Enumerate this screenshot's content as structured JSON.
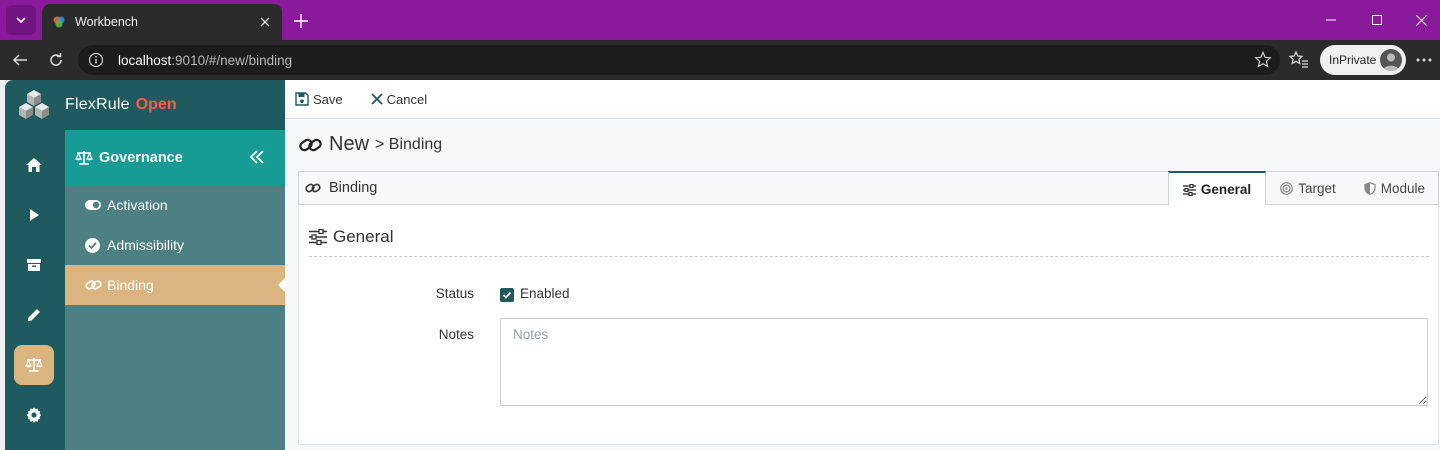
{
  "browser": {
    "tab_title": "Workbench",
    "url_host": "localhost",
    "url_rest": ":9010/#/new/binding",
    "profile_label": "InPrivate"
  },
  "app": {
    "brand": "FlexRule",
    "brand_accent": "Open",
    "colors": {
      "teal_dark": "#1f5a5e",
      "teal": "#169c94",
      "sand": "#dbb57f",
      "accent": "#ff5a4a"
    },
    "rail_icons": [
      "home-icon",
      "play-icon",
      "archive-icon",
      "pencil-icon",
      "scale-icon",
      "gear-icon"
    ],
    "menu": {
      "title": "Governance",
      "items": [
        {
          "label": "Activation",
          "icon": "toggle-icon"
        },
        {
          "label": "Admissibility",
          "icon": "check-circle-icon"
        },
        {
          "label": "Binding",
          "icon": "link-icon",
          "active": true
        }
      ]
    },
    "actions": {
      "save": "Save",
      "cancel": "Cancel"
    },
    "page": {
      "title": "New",
      "crumb": "> Binding"
    },
    "panel": {
      "label": "Binding",
      "tabs": [
        {
          "label": "General",
          "active": true
        },
        {
          "label": "Target"
        },
        {
          "label": "Module"
        }
      ]
    },
    "section": {
      "title": "General",
      "status_label": "Status",
      "status_option": "Enabled",
      "status_checked": true,
      "notes_label": "Notes",
      "notes_placeholder": "Notes",
      "notes_value": ""
    }
  }
}
